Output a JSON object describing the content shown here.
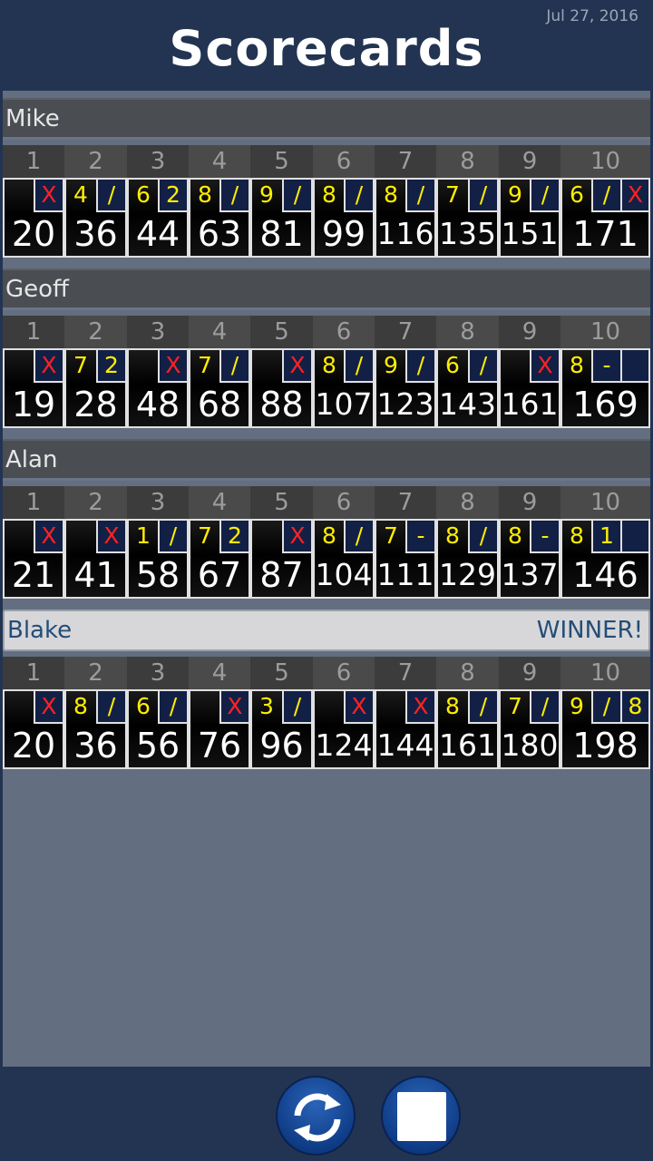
{
  "header": {
    "title": "Scorecards",
    "date": "Jul 27, 2016"
  },
  "frame_numbers": [
    "1",
    "2",
    "3",
    "4",
    "5",
    "6",
    "7",
    "8",
    "9",
    "10"
  ],
  "winner_label": "WINNER!",
  "players": [
    {
      "name": "Mike",
      "winner": false,
      "frames": [
        {
          "rolls": [
            "",
            "X"
          ],
          "total": "20"
        },
        {
          "rolls": [
            "4",
            "/"
          ],
          "total": "36"
        },
        {
          "rolls": [
            "6",
            "2"
          ],
          "total": "44"
        },
        {
          "rolls": [
            "8",
            "/"
          ],
          "total": "63"
        },
        {
          "rolls": [
            "9",
            "/"
          ],
          "total": "81"
        },
        {
          "rolls": [
            "8",
            "/"
          ],
          "total": "99"
        },
        {
          "rolls": [
            "8",
            "/"
          ],
          "total": "116"
        },
        {
          "rolls": [
            "7",
            "/"
          ],
          "total": "135"
        },
        {
          "rolls": [
            "9",
            "/"
          ],
          "total": "151"
        },
        {
          "rolls": [
            "6",
            "/",
            "X"
          ],
          "total": "171"
        }
      ]
    },
    {
      "name": "Geoff",
      "winner": false,
      "frames": [
        {
          "rolls": [
            "",
            "X"
          ],
          "total": "19"
        },
        {
          "rolls": [
            "7",
            "2"
          ],
          "total": "28"
        },
        {
          "rolls": [
            "",
            "X"
          ],
          "total": "48"
        },
        {
          "rolls": [
            "7",
            "/"
          ],
          "total": "68"
        },
        {
          "rolls": [
            "",
            "X"
          ],
          "total": "88"
        },
        {
          "rolls": [
            "8",
            "/"
          ],
          "total": "107"
        },
        {
          "rolls": [
            "9",
            "/"
          ],
          "total": "123"
        },
        {
          "rolls": [
            "6",
            "/"
          ],
          "total": "143"
        },
        {
          "rolls": [
            "",
            "X"
          ],
          "total": "161"
        },
        {
          "rolls": [
            "8",
            "-",
            ""
          ],
          "total": "169"
        }
      ]
    },
    {
      "name": "Alan",
      "winner": false,
      "frames": [
        {
          "rolls": [
            "",
            "X"
          ],
          "total": "21"
        },
        {
          "rolls": [
            "",
            "X"
          ],
          "total": "41"
        },
        {
          "rolls": [
            "1",
            "/"
          ],
          "total": "58"
        },
        {
          "rolls": [
            "7",
            "2"
          ],
          "total": "67"
        },
        {
          "rolls": [
            "",
            "X"
          ],
          "total": "87"
        },
        {
          "rolls": [
            "8",
            "/"
          ],
          "total": "104"
        },
        {
          "rolls": [
            "7",
            "-"
          ],
          "total": "111"
        },
        {
          "rolls": [
            "8",
            "/"
          ],
          "total": "129"
        },
        {
          "rolls": [
            "8",
            "-"
          ],
          "total": "137"
        },
        {
          "rolls": [
            "8",
            "1",
            ""
          ],
          "total": "146"
        }
      ]
    },
    {
      "name": "Blake",
      "winner": true,
      "frames": [
        {
          "rolls": [
            "",
            "X"
          ],
          "total": "20"
        },
        {
          "rolls": [
            "8",
            "/"
          ],
          "total": "36"
        },
        {
          "rolls": [
            "6",
            "/"
          ],
          "total": "56"
        },
        {
          "rolls": [
            "",
            "X"
          ],
          "total": "76"
        },
        {
          "rolls": [
            "3",
            "/"
          ],
          "total": "96"
        },
        {
          "rolls": [
            "",
            "X"
          ],
          "total": "124"
        },
        {
          "rolls": [
            "",
            "X"
          ],
          "total": "144"
        },
        {
          "rolls": [
            "8",
            "/"
          ],
          "total": "161"
        },
        {
          "rolls": [
            "7",
            "/"
          ],
          "total": "180"
        },
        {
          "rolls": [
            "9",
            "/",
            "8"
          ],
          "total": "198"
        }
      ]
    }
  ],
  "footer": {
    "restart_icon": "refresh-icon",
    "stop_icon": "stop-icon"
  },
  "colors": {
    "mark": "#ffee00",
    "strike": "#ff2222",
    "winner_text": "#244d78"
  }
}
